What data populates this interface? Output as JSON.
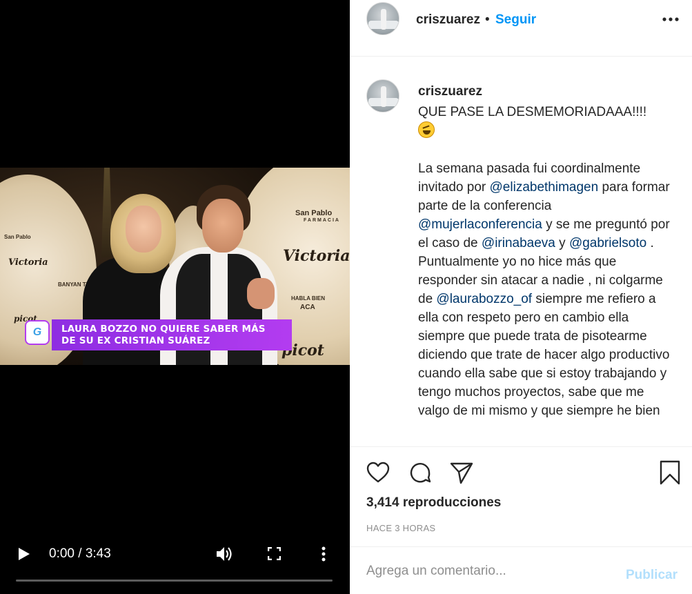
{
  "video": {
    "banner_line1": "LAURA BOZZO NO QUIERE SABER MÁS",
    "banner_line2": "DE SU EX CRISTIAN SUÁREZ",
    "channel_logo": "G",
    "background_logos": {
      "san_pablo": "San Pablo",
      "farmacia": "FARMACIA",
      "victoria": "Victoria",
      "picot": "picot",
      "habla_bien": "HABLA BIEN",
      "aca": "ACA",
      "banyan": "BANYAN TR"
    },
    "time": "0:00 / 3:43",
    "progress_fraction": 0.0,
    "icons": [
      "play-icon",
      "volume-icon",
      "fullscreen-icon",
      "more-vertical-icon"
    ]
  },
  "header": {
    "username": "criszuarez",
    "separator": "•",
    "follow_label": "Seguir"
  },
  "caption": {
    "username": "criszuarez",
    "line1": "QUE PASE LA DESMEMORIADAAA!!!!",
    "p2_a": "La semana pasada fui coordinalmente invitado por ",
    "m1": "@elizabethimagen",
    "p2_b": " para formar parte de la conferencia ",
    "m2": "@mujerlaconferencia",
    "p2_c": " y se me preguntó por el caso de ",
    "m3": "@irinabaeva",
    "p2_d": " y ",
    "m4": "@gabrielsoto",
    "p2_e": " . Puntualmente yo no hice más que responder sin atacar a nadie , ni colgarme de ",
    "m5": "@laurabozzo_of",
    "p2_f": " siempre me refiero a ella con respeto pero en cambio ella siempre que puede trata de pisotearme diciendo que trate de hacer algo productivo cuando ella sabe que si estoy trabajando y tengo muchos proyectos, sabe que me valgo de mi mismo y que siempre he bien"
  },
  "actions": {
    "views": "3,414 reproducciones",
    "time_ago": "HACE 3 HORAS",
    "icons": [
      "heart-icon",
      "comment-icon",
      "share-icon",
      "bookmark-icon"
    ]
  },
  "comment": {
    "placeholder": "Agrega un comentario...",
    "publish_label": "Publicar"
  },
  "colors": {
    "accent": "#0095f6",
    "mention": "#00376b",
    "publish_disabled": "#b2dffc",
    "banner": "#b33cf0"
  }
}
